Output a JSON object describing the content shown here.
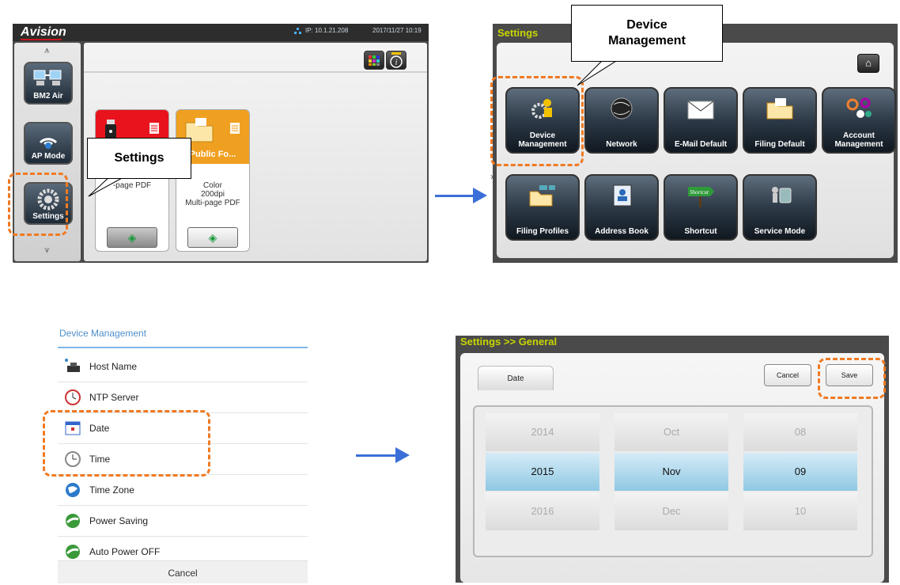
{
  "panel_a": {
    "brand": "Avision",
    "ip": "IP: 10.1.21.208",
    "datetime": "2017/11/27 10:19",
    "sidebar": [
      {
        "label": "BM2 Air",
        "icon": "bm2-air-icon"
      },
      {
        "label": "AP Mode",
        "icon": "ap-mode-icon"
      },
      {
        "label": "Settings",
        "icon": "settings-gear-icon"
      }
    ],
    "cards": [
      {
        "title": "",
        "line1": "",
        "line2": "",
        "line3": "-page PDF",
        "color": "#e8131d"
      },
      {
        "title": "Public Fo...",
        "line1": "Color",
        "line2": "200dpi",
        "line3": "Multi-page PDF",
        "color": "#f0a020"
      }
    ],
    "more": "»",
    "callout": "Settings"
  },
  "panel_b": {
    "title": "Settings",
    "callout": "Device Management",
    "tiles": [
      {
        "label": "Device Management",
        "icon": "device-management-icon"
      },
      {
        "label": "Network",
        "icon": "network-globe-icon"
      },
      {
        "label": "E-Mail Default",
        "icon": "email-envelope-icon"
      },
      {
        "label": "Filing Default",
        "icon": "filing-folder-icon"
      },
      {
        "label": "Account Management",
        "icon": "account-gears-icon"
      },
      {
        "label": "Filing Profiles",
        "icon": "filing-profiles-icon"
      },
      {
        "label": "Address Book",
        "icon": "address-book-icon"
      },
      {
        "label": "Shortcut",
        "icon": "shortcut-sign-icon"
      },
      {
        "label": "Service Mode",
        "icon": "service-mode-icon"
      }
    ],
    "shortcut_sign": "Shortcut"
  },
  "panel_c": {
    "header": "Device Management",
    "items": [
      {
        "label": "Host Name",
        "icon": "host-name-icon"
      },
      {
        "label": "NTP Server",
        "icon": "ntp-server-icon"
      },
      {
        "label": "Date",
        "icon": "date-calendar-icon"
      },
      {
        "label": "Time",
        "icon": "time-clock-icon"
      },
      {
        "label": "Time Zone",
        "icon": "time-zone-globe-icon"
      },
      {
        "label": "Power Saving",
        "icon": "power-saving-icon"
      },
      {
        "label": "Auto Power OFF",
        "icon": "auto-power-off-icon"
      }
    ],
    "cancel": "Cancel"
  },
  "panel_d": {
    "title": "Settings >> General",
    "tab": "Date",
    "cancel": "Cancel",
    "save": "Save",
    "years": [
      "2014",
      "2015",
      "2016"
    ],
    "months": [
      "Oct",
      "Nov",
      "Dec"
    ],
    "days": [
      "08",
      "09",
      "10"
    ],
    "selected_index": 1
  },
  "colors": {
    "accent_dash": "#f07a22",
    "arrow": "#3b6fd8",
    "title_yellow": "#c8d600"
  }
}
